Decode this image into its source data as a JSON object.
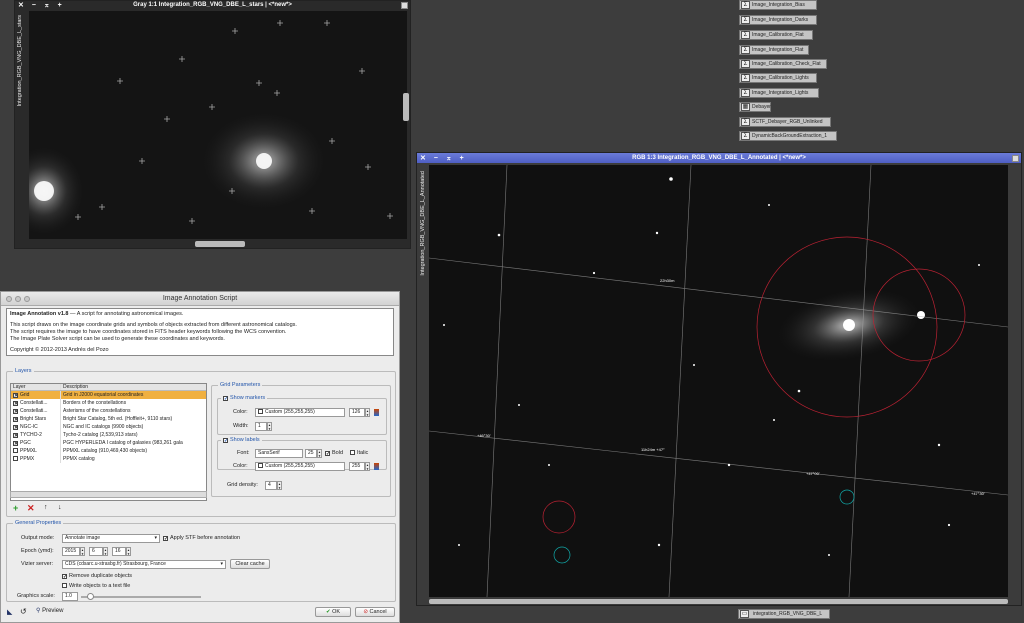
{
  "gray_window": {
    "title": "Gray 1:1 Integration_RGB_VNG_DBE_L_stars | <*new*>",
    "side_label": "Integration_RGB_VNG_DBE_L_stars"
  },
  "rgb_window": {
    "title": "RGB 1:3 Integration_RGB_VNG_DBE_L_Annotated | <*new*>",
    "side_label": "Integration_RGB_VNG_DBE_L_Annotated",
    "annotations": [
      "22h30m",
      "+46°30'",
      "11h24m +47°",
      "+47°00'",
      "+47°30'"
    ]
  },
  "process_icons": [
    "Image_Integration_Bias",
    "Image_Integration_Darks",
    "Image_Calibration_Flat",
    "Image_Integration_Flat",
    "Image_Calibration_Check_Flat",
    "Image_Calibration_Lights",
    "Image_Integration_Lights",
    "Debayer",
    "SCTF_Debayer_RGB_Unlinked",
    "DynamicBackGroundExtraction_1"
  ],
  "bottom_icon": "integration_RGB_VNG_DBE_L",
  "dialog": {
    "title": "Image Annotation Script",
    "info_heading": "Image Annotation v1.8",
    "info_heading_rest": " — A script for annotating astronomical images.",
    "info_line1": "This script draws on the image coordinate grids and symbols of objects extracted from different astronomical catalogs.",
    "info_line2": "The script requires the image to have coordinates stored in FITS header keywords following the WCS convention.",
    "info_line3": "The Image Plate Solver script can be used to generate these coordinates and keywords.",
    "info_copyright": "Copyright © 2012-2013 Andrés del Pozo",
    "layers_label": "Layers",
    "col_layer": "Layer",
    "col_desc": "Description",
    "layers": [
      {
        "name": "Grid",
        "desc": "Grid in J2000 equatorial coordinates",
        "checked": "✕"
      },
      {
        "name": "Constellati...",
        "desc": "Borders of the constellations",
        "checked": "✕"
      },
      {
        "name": "Constellati...",
        "desc": "Asterisms of the constellations",
        "checked": "✕"
      },
      {
        "name": "Bright Stars",
        "desc": "Bright Star Catalog, 5th ed. (Hoffleit+, 9110 stars)",
        "checked": "✕"
      },
      {
        "name": "NGC-IC",
        "desc": "NGC and IC catalogs (9900 objects)",
        "checked": "✕"
      },
      {
        "name": "TYCHO-2",
        "desc": "Tycho-2 catalog (2,539,913 stars)",
        "checked": "✕"
      },
      {
        "name": "PGC",
        "desc": "PGC HYPERLEDA I catalog of galaxies (983,261 gala",
        "checked": "✕"
      },
      {
        "name": "PPMXL",
        "desc": "PPMXL catalog (910,469,430 objects)",
        "checked": ""
      },
      {
        "name": "PPMX",
        "desc": "PPMX catalog",
        "checked": ""
      }
    ],
    "grid_params_label": "Grid Parameters",
    "show_markers_label": "Show markers",
    "color_label": "Color:",
    "marker_color": "Custom (255,255,255)",
    "marker_alpha": "126",
    "width_label": "Width:",
    "marker_width": "1",
    "show_labels_label": "Show labels",
    "font_label": "Font:",
    "font_value": "SansSerif",
    "font_size": "25",
    "bold_label": "Bold",
    "italic_label": "Italic",
    "label_color": "Custom (255,255,255)",
    "label_alpha": "255",
    "grid_density_label": "Grid density:",
    "grid_density": "4",
    "general_label": "General Properties",
    "output_mode_label": "Output mode:",
    "output_mode": "Annotate image",
    "apply_stf_label": "Apply STF before annotation",
    "epoch_label": "Epoch (ymd):",
    "epoch_y": "2015",
    "epoch_m": "6",
    "epoch_d": "16",
    "vizier_label": "Vizier server:",
    "vizier_value": "CDS (cdsarc.u-strasbg.fr) Strasbourg, France",
    "clear_cache": "Clear cache",
    "remove_dup_label": "Remove duplicate objects",
    "write_objects_label": "Write objects to a text file",
    "graphics_scale_label": "Graphics scale:",
    "graphics_scale": "1.0",
    "preview_label": "Preview",
    "ok_label": "OK",
    "cancel_label": "Cancel"
  }
}
